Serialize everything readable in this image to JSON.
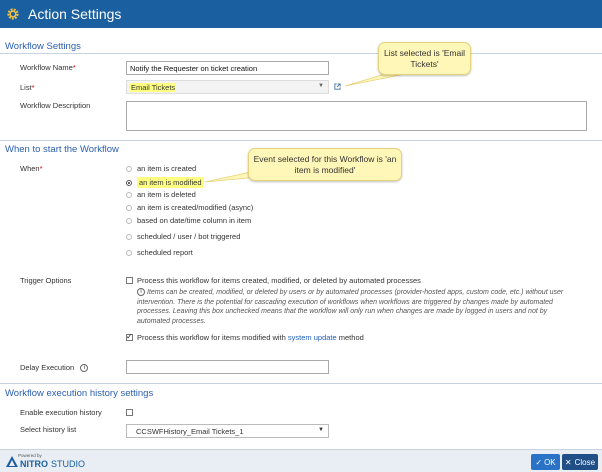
{
  "window": {
    "title": "Action Settings"
  },
  "sections": {
    "workflow_settings": "Workflow Settings",
    "when_to_start": "When to start the Workflow",
    "history": "Workflow execution history settings"
  },
  "fields": {
    "workflow_name_label": "Workflow Name",
    "workflow_name_value": "Notify the Requester on ticket creation",
    "list_label": "List",
    "list_value": "Email Tickets",
    "description_label": "Workflow Description",
    "when_label": "When",
    "trigger_label": "Trigger Options",
    "delay_label": "Delay Execution",
    "enable_history_label": "Enable execution history",
    "history_list_label": "Select history list",
    "history_list_value": "CCSWFHistory_Email Tickets_1"
  },
  "when_options": [
    {
      "label": "an item is created",
      "checked": false
    },
    {
      "label": "an item is modified",
      "checked": true
    },
    {
      "label": "an item is deleted",
      "checked": false
    },
    {
      "label": "an item is created/modified (async)",
      "checked": false
    },
    {
      "label": "based on date/time column in item",
      "checked": false
    },
    {
      "label": "scheduled / user / bot triggered",
      "checked": false
    },
    {
      "label": "scheduled report",
      "checked": false
    }
  ],
  "trigger": {
    "automated_label": "Process this workflow for items created, modified, or deleted by automated processes",
    "automated_checked": false,
    "info": "Items can be created, modified, or deleted by users or by automated processes (provider-hosted apps, custom code, etc.) without user intervention. There is the potential for cascading execution of workflows when workflows are triggered by changes made by automated processes. Leaving this box unchecked means that the workflow will only run when changes are made by logged in users and not by automated processes.",
    "system_update_prefix": "Process this workflow for items modified with",
    "system_update_link": "system update",
    "system_update_suffix": "method",
    "system_update_checked": true
  },
  "callouts": {
    "list": "List selected is 'Email Tickets'",
    "event": "Event selected for this Workflow is 'an item is modified'"
  },
  "footer": {
    "powered_by": "Powered by",
    "brand_name": "NITRO",
    "brand_suffix": "STUDIO",
    "ok_label": "OK",
    "close_label": "Close"
  },
  "colors": {
    "header": "#1a5fa0",
    "accent": "#2a72c7",
    "highlight": "#ffff80",
    "callout": "#fff7b8"
  }
}
